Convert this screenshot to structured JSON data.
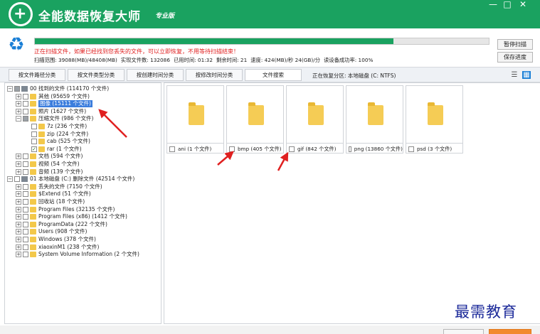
{
  "app": {
    "title": "全能数据恢复大师",
    "edition": "专业版"
  },
  "window": {
    "minimize": "—",
    "maximize": "□",
    "close": "✕"
  },
  "scan": {
    "progress": 0.79,
    "message": "正在扫描文件，如果已经找到您丢失的文件，可以立即恢复，不用等待扫描结束！",
    "stats": [
      "扫描范围: 39088(MB)/48408(MB)",
      "实现文件数: 132086",
      "已用时间: 01:32",
      "剩余时间: 21",
      "速度: 424(MB)/秒  24(GB)/分",
      "读设备成功率: 100%"
    ],
    "pause_label": "暂停扫描",
    "save_label": "保存进度"
  },
  "tabs": [
    {
      "label": "按文件路径分类",
      "active": false
    },
    {
      "label": "按文件类型分类",
      "active": false
    },
    {
      "label": "按创建时间分类",
      "active": false
    },
    {
      "label": "按修改时间分类",
      "active": false
    },
    {
      "label": "文件搜索",
      "active": true
    }
  ],
  "current_partition": "正在恢复分区: 本地磁盘 (C: NTFS)",
  "tree": [
    {
      "text": "00 找到的文件   (114170 个文件)",
      "icon": "drive-icon",
      "check": "partial",
      "exp": "−"
    },
    {
      "text": "其他   (95659 个文件)",
      "icon": "folder-icon",
      "check": "none",
      "exp": "+"
    },
    {
      "text": "图像   (15111 个文件)",
      "icon": "folder-icon",
      "check": "none",
      "exp": "+",
      "selected": true
    },
    {
      "text": "照片   (1627 个文件)",
      "icon": "folder-icon",
      "check": "none",
      "exp": "+"
    },
    {
      "text": "压缩文件   (986 个文件)",
      "icon": "folder-icon",
      "check": "partial",
      "exp": "−"
    },
    {
      "text": "7z   (236 个文件)",
      "icon": "folder-icon",
      "check": "none",
      "exp": ""
    },
    {
      "text": "zip   (224 个文件)",
      "icon": "folder-icon",
      "check": "none",
      "exp": ""
    },
    {
      "text": "cab   (525 个文件)",
      "icon": "folder-icon",
      "check": "none",
      "exp": ""
    },
    {
      "text": "rar   (1 个文件)",
      "icon": "folder-icon",
      "check": "checked",
      "exp": ""
    },
    {
      "text": "文档   (594 个文件)",
      "icon": "folder-icon",
      "check": "none",
      "exp": "+"
    },
    {
      "text": "视频   (54 个文件)",
      "icon": "folder-icon",
      "check": "none",
      "exp": "+"
    },
    {
      "text": "音频   (139 个文件)",
      "icon": "folder-icon",
      "check": "none",
      "exp": "+"
    },
    {
      "text": "01 本地磁盘 (C:) 删除文件  (42514 个文件)",
      "icon": "drive-icon",
      "check": "none",
      "exp": "−"
    },
    {
      "text": "丢失的文件   (7150 个文件)",
      "icon": "folder-icon",
      "check": "none",
      "exp": "+"
    },
    {
      "text": "$Extend   (51 个文件)",
      "icon": "folder-icon",
      "check": "none",
      "exp": "+"
    },
    {
      "text": "回收站   (18 个文件)",
      "icon": "folder-icon",
      "check": "none",
      "exp": "+"
    },
    {
      "text": "Program Files   (32135 个文件)",
      "icon": "folder-icon",
      "check": "none",
      "exp": "+"
    },
    {
      "text": "Program Files (x86)   (1412 个文件)",
      "icon": "folder-icon",
      "check": "none",
      "exp": "+"
    },
    {
      "text": "ProgramData   (222 个文件)",
      "icon": "folder-icon",
      "check": "none",
      "exp": "+"
    },
    {
      "text": "Users   (908 个文件)",
      "icon": "folder-icon",
      "check": "none",
      "exp": "+"
    },
    {
      "text": "Windows   (378 个文件)",
      "icon": "folder-icon",
      "check": "none",
      "exp": "+"
    },
    {
      "text": "xiaoxinM1   (238 个文件)",
      "icon": "folder-icon",
      "check": "none",
      "exp": "+"
    },
    {
      "text": "System Volume Information   (2 个文件)",
      "icon": "folder-icon",
      "check": "none",
      "exp": "+"
    }
  ],
  "thumbnails": [
    {
      "label": "ani   (1 个文件)"
    },
    {
      "label": "bmp   (405 个文件)"
    },
    {
      "label": "gif   (842 个文件)"
    },
    {
      "label": "png   (13860 个文件)"
    },
    {
      "label": "psd   (3 个文件)"
    }
  ],
  "watermark": "最需教育",
  "colors": {
    "brand": "#1aa260",
    "selected": "#3b7ddd",
    "warning": "#e02020",
    "arrow": "#e02020"
  }
}
